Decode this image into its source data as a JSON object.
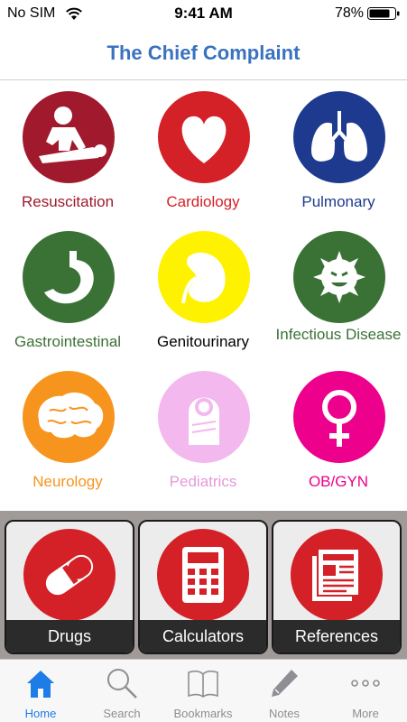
{
  "status_bar": {
    "carrier": "No SIM",
    "time": "9:41 AM",
    "battery": "78%"
  },
  "nav": {
    "title": "The Chief Complaint"
  },
  "categories": [
    {
      "label": "Resuscitation",
      "color": "#a0192c",
      "text_color": "#a0192c",
      "icon": "cpr-icon"
    },
    {
      "label": "Cardiology",
      "color": "#d42027",
      "text_color": "#d42027",
      "icon": "heart-icon"
    },
    {
      "label": "Pulmonary",
      "color": "#1d3a8f",
      "text_color": "#1d3a8f",
      "icon": "lungs-icon"
    },
    {
      "label": "Gastrointestinal",
      "color": "#3a7236",
      "text_color": "#3a7236",
      "icon": "stomach-icon"
    },
    {
      "label": "Genitourinary",
      "color": "#fff200",
      "text_color": "#000000",
      "icon": "kidney-icon"
    },
    {
      "label": "Infectious Disease",
      "color": "#3a7236",
      "text_color": "#3a7236",
      "icon": "germ-icon"
    },
    {
      "label": "Neurology",
      "color": "#f7941d",
      "text_color": "#f7941d",
      "icon": "brain-icon"
    },
    {
      "label": "Pediatrics",
      "color": "#f3b8ee",
      "text_color": "#e49ad9",
      "icon": "baby-icon"
    },
    {
      "label": "OB/GYN",
      "color": "#ec008c",
      "text_color": "#ec008c",
      "icon": "female-symbol-icon"
    }
  ],
  "tiles": [
    {
      "label": "Drugs",
      "icon": "capsule-icon"
    },
    {
      "label": "Calculators",
      "icon": "calculator-icon"
    },
    {
      "label": "References",
      "icon": "newspaper-icon"
    }
  ],
  "tab_bar": {
    "items": [
      {
        "label": "Home",
        "icon": "house-icon",
        "active": true
      },
      {
        "label": "Search",
        "icon": "magnifier-icon",
        "active": false
      },
      {
        "label": "Bookmarks",
        "icon": "book-icon",
        "active": false
      },
      {
        "label": "Notes",
        "icon": "pencil-icon",
        "active": false
      },
      {
        "label": "More",
        "icon": "ellipsis-icon",
        "active": false
      }
    ],
    "active_color": "#1d7ce5",
    "inactive_color": "#8e8e93"
  }
}
